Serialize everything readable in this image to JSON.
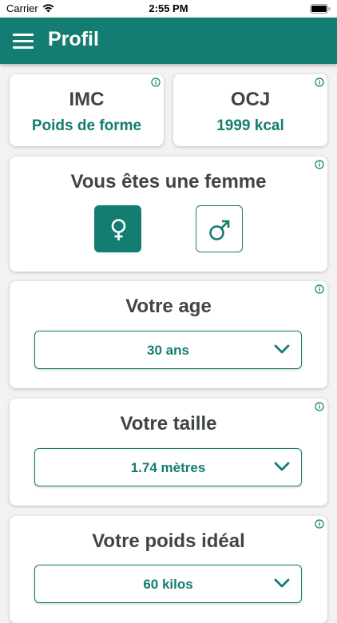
{
  "status_bar": {
    "carrier": "Carrier",
    "time": "2:55 PM"
  },
  "header": {
    "title": "Profil",
    "menu_icon": "hamburger-menu-icon"
  },
  "colors": {
    "primary": "#137d71",
    "text_dark": "#3f4544",
    "background": "#f2f2f2"
  },
  "imc": {
    "title": "IMC",
    "value": "Poids de forme"
  },
  "ocj": {
    "title": "OCJ",
    "value": "1999 kcal"
  },
  "gender": {
    "title": "Vous êtes une femme",
    "selected": "female",
    "options": [
      {
        "id": "female",
        "icon": "female-symbol-icon"
      },
      {
        "id": "male",
        "icon": "male-symbol-icon"
      }
    ]
  },
  "age": {
    "title": "Votre age",
    "value": "30 ans"
  },
  "height": {
    "title": "Votre taille",
    "value": "1.74 mètres"
  },
  "ideal_weight": {
    "title": "Votre poids idéal",
    "value": "60 kilos"
  }
}
